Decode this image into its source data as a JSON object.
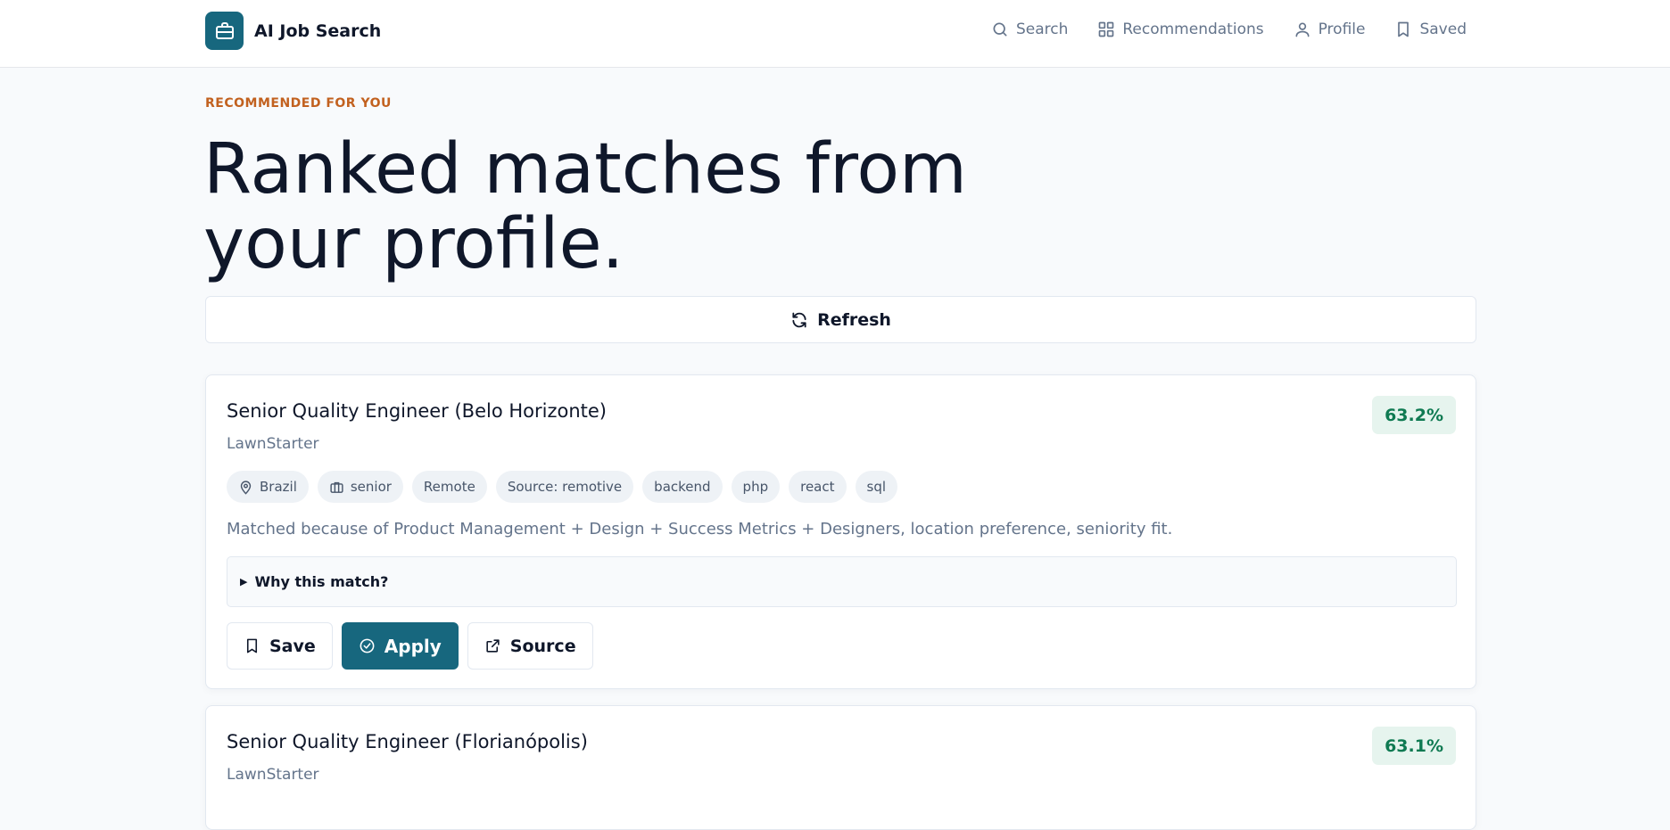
{
  "app": {
    "name": "AI Job Search",
    "brand_color": "#17677e"
  },
  "nav": [
    {
      "label": "Search",
      "icon": "search-icon"
    },
    {
      "label": "Recommendations",
      "icon": "grid-icon"
    },
    {
      "label": "Profile",
      "icon": "user-icon"
    },
    {
      "label": "Saved",
      "icon": "bookmark-icon"
    }
  ],
  "page": {
    "eyebrow": "RECOMMENDED FOR YOU",
    "title": "Ranked matches from your profile.",
    "refresh_label": "Refresh"
  },
  "jobs": [
    {
      "title": "Senior Quality Engineer (Belo Horizonte)",
      "company": "LawnStarter",
      "score": "63.2%",
      "location": "Brazil",
      "seniority": "senior",
      "tags": [
        "Remote",
        "Source: remotive",
        "backend",
        "php",
        "react",
        "sql"
      ],
      "reason": "Matched because of Product Management + Design + Success Metrics + Designers, location preference, seniority fit.",
      "why_label": "Why this match?",
      "actions": {
        "save": "Save",
        "apply": "Apply",
        "source": "Source"
      }
    },
    {
      "title": "Senior Quality Engineer (Florianópolis)",
      "company": "LawnStarter",
      "score": "63.1%"
    }
  ],
  "colors": {
    "eyebrow": "#c2611f",
    "score_bg": "#e6f4ee",
    "score_text": "#0f7a52"
  }
}
